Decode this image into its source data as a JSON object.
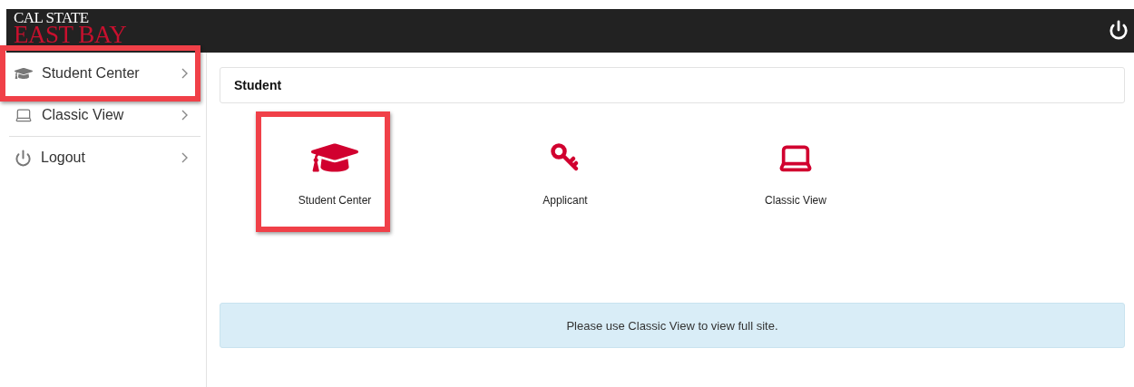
{
  "header": {
    "logo_top": "CAL STATE",
    "logo_bottom": "EAST BAY"
  },
  "sidebar": {
    "items": [
      {
        "label": "Student Center",
        "kind": "cap",
        "highlighted": true
      },
      {
        "label": "Classic View",
        "kind": "laptop",
        "highlighted": false
      },
      {
        "label": "Logout",
        "kind": "power",
        "highlighted": false
      }
    ]
  },
  "section": {
    "title": "Student"
  },
  "tiles": [
    {
      "label": "Student Center",
      "kind": "cap",
      "highlighted": true
    },
    {
      "label": "Applicant",
      "kind": "key",
      "highlighted": false
    },
    {
      "label": "Classic View",
      "kind": "laptop",
      "highlighted": false
    }
  ],
  "notice": "Please use Classic View to view full site."
}
